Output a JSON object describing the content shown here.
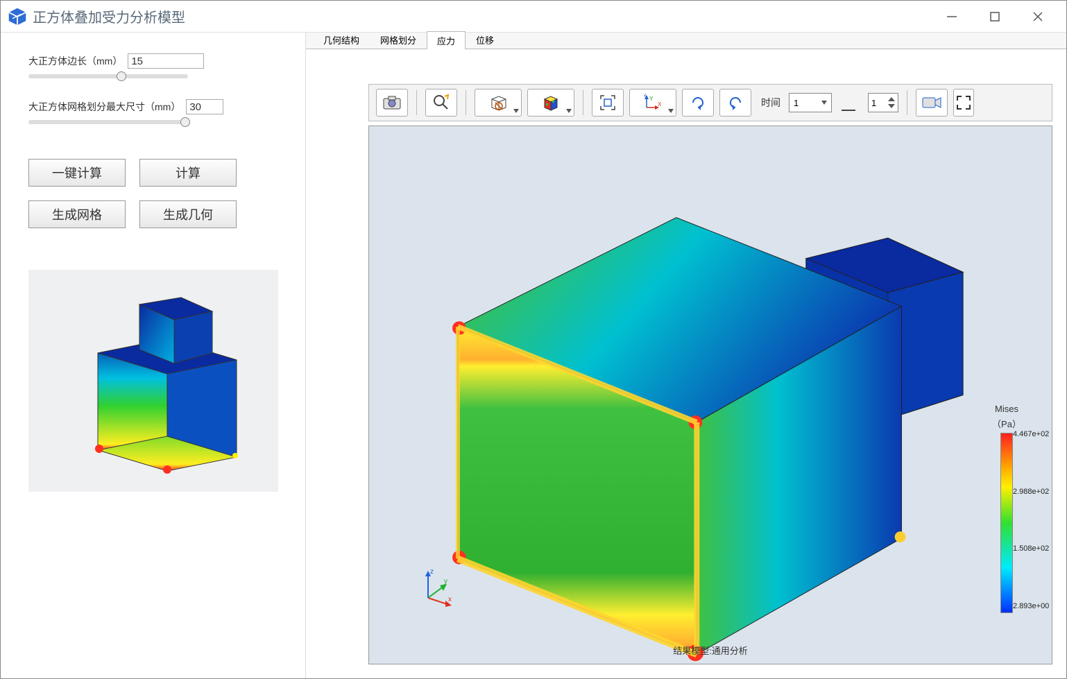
{
  "window": {
    "title": "正方体叠加受力分析模型"
  },
  "sidebar": {
    "param1_label": "大正方体边长（mm）",
    "param1_value": "15",
    "param2_label": "大正方体网格划分最大尺寸（mm）",
    "param2_value": "30",
    "btn_onekey": "一键计算",
    "btn_compute": "计算",
    "btn_mesh": "生成网格",
    "btn_geom": "生成几何"
  },
  "tabs": {
    "geom": "几何结构",
    "mesh": "网格划分",
    "stress": "应力",
    "disp": "位移"
  },
  "toolbar": {
    "time_label": "时间",
    "time_value": "1",
    "step_value": "1"
  },
  "viewport": {
    "bottom_label": "结果模型:通用分析"
  },
  "legend": {
    "title_l1": "Mises",
    "title_l2": "（Pa）",
    "v0": "4.467e+02",
    "v1": "2.988e+02",
    "v2": "1.508e+02",
    "v3": "2.893e+00"
  }
}
